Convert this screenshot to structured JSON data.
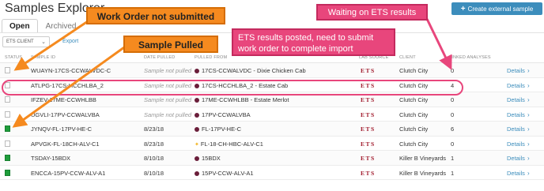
{
  "page": {
    "title": "Samples Explorer"
  },
  "tabs": [
    {
      "label": "Open",
      "active": true
    },
    {
      "label": "Archived",
      "active": false
    }
  ],
  "filter": {
    "value": "ETS CLIENT"
  },
  "export_label": "Export",
  "create_button": {
    "icon": "plus-icon",
    "label": "Create external sample"
  },
  "columns": [
    "STATUS",
    "SAMPLE ID",
    "DATE PULLED",
    "PULLED FROM",
    "LAB SOURCE",
    "CLIENT",
    "LINKED ANALYSES"
  ],
  "rows": [
    {
      "status": "empty",
      "sample_id": "WUAYN-17CS-CCWALVDC-C",
      "date_pulled": "Sample not pulled",
      "pulled_from": "17CS-CCWALVDC - Dixie Chicken Cab",
      "source_icon": "wine",
      "lab": "ETS",
      "client": "Clutch City",
      "linked": "0",
      "details": "Details"
    },
    {
      "status": "empty",
      "sample_id": "ATLPG-17CS-HCCHLBA_2",
      "date_pulled": "Sample not pulled",
      "pulled_from": "17CS-HCCHLBA_2 - Estate Cab",
      "source_icon": "wine",
      "lab": "ETS",
      "client": "Clutch City",
      "linked": "4",
      "details": "Details"
    },
    {
      "status": "empty",
      "sample_id": "IFZEV-17ME-CCWHLBB",
      "date_pulled": "Sample not pulled",
      "pulled_from": "17ME-CCWHLBB - Estate Merlot",
      "source_icon": "wine",
      "lab": "ETS",
      "client": "Clutch City",
      "linked": "0",
      "details": "Details"
    },
    {
      "status": "empty",
      "sample_id": "UGVLI-17PV-CCWALVBA",
      "date_pulled": "Sample not pulled",
      "pulled_from": "17PV-CCWALVBA",
      "source_icon": "wine",
      "lab": "ETS",
      "client": "Clutch City",
      "linked": "0",
      "details": "Details"
    },
    {
      "status": "green",
      "sample_id": "JYNQV-FL-17PV-HE-C",
      "date_pulled": "8/23/18",
      "pulled_from": "FL-17PV-HE-C",
      "source_icon": "wine",
      "lab": "ETS",
      "client": "Clutch City",
      "linked": "6",
      "details": "Details"
    },
    {
      "status": "empty",
      "sample_id": "APVGK-FL-18CH-ALV-C1",
      "date_pulled": "8/23/18",
      "pulled_from": "FL-18-CH-HBC-ALV-C1",
      "source_icon": "star",
      "lab": "ETS",
      "client": "Clutch City",
      "linked": "0",
      "details": "Details"
    },
    {
      "status": "green",
      "sample_id": "TSDAY-15BDX",
      "date_pulled": "8/10/18",
      "pulled_from": "15BDX",
      "source_icon": "wine",
      "lab": "ETS",
      "client": "Killer B Vineyards",
      "linked": "1",
      "details": "Details"
    },
    {
      "status": "green",
      "sample_id": "ENCCA-15PV-CCW-ALV-A1",
      "date_pulled": "8/10/18",
      "pulled_from": "15PV-CCW-ALV-A1",
      "source_icon": "wine",
      "lab": "ETS",
      "client": "Killer B Vineyards",
      "linked": "1",
      "details": "Details"
    }
  ],
  "annotations": {
    "work_order": "Work Order not submitted",
    "sample_pulled": "Sample Pulled",
    "waiting": "Waiting on ETS results",
    "results_posted": "ETS results posted, need to submit work order to complete import"
  },
  "colors": {
    "accent": "#3c8dbc",
    "callout_orange": "#f58a1f",
    "callout_pink": "#e8467c",
    "status_green": "#1f9d3b",
    "lab_red": "#a0182a"
  }
}
